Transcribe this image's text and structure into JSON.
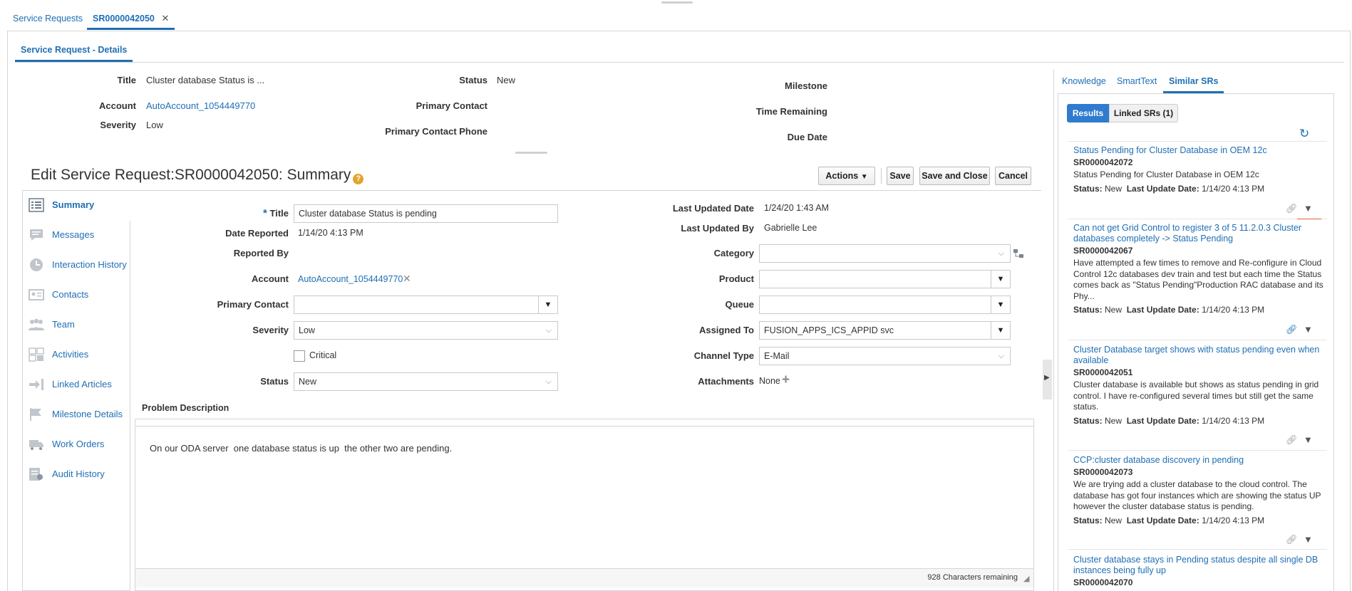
{
  "tabs": [
    {
      "label": "Service Requests"
    },
    {
      "label": "SR0000042050"
    }
  ],
  "subtab": "Service Request - Details",
  "header": {
    "title_label": "Title",
    "title_value": "Cluster database Status is ...",
    "account_label": "Account",
    "account_value": "AutoAccount_1054449770",
    "severity_label": "Severity",
    "severity_value": "Low",
    "status_label": "Status",
    "status_value": "New",
    "primary_contact_label": "Primary Contact",
    "primary_contact_phone_label": "Primary Contact Phone",
    "milestone_label": "Milestone",
    "time_remaining_label": "Time Remaining",
    "due_date_label": "Due Date"
  },
  "edit": {
    "heading": "Edit Service Request:SR0000042050: Summary",
    "actions_label": "Actions",
    "save_label": "Save",
    "save_close_label": "Save and Close",
    "cancel_label": "Cancel"
  },
  "sidebar": {
    "items": [
      {
        "label": "Summary",
        "icon": "list-icon"
      },
      {
        "label": "Messages",
        "icon": "message-icon"
      },
      {
        "label": "Interaction History",
        "icon": "clock-icon"
      },
      {
        "label": "Contacts",
        "icon": "contact-card-icon"
      },
      {
        "label": "Team",
        "icon": "team-icon"
      },
      {
        "label": "Activities",
        "icon": "activities-icon"
      },
      {
        "label": "Linked Articles",
        "icon": "linked-articles-icon"
      },
      {
        "label": "Milestone Details",
        "icon": "flag-icon"
      },
      {
        "label": "Work Orders",
        "icon": "truck-icon"
      },
      {
        "label": "Audit History",
        "icon": "audit-icon"
      }
    ]
  },
  "form": {
    "required_star": "*",
    "title_label": "Title",
    "title_value": "Cluster database Status is pending",
    "date_reported_label": "Date Reported",
    "date_reported_value": "1/14/20 4:13 PM",
    "reported_by_label": "Reported By",
    "account_label": "Account",
    "account_value": "AutoAccount_1054449770",
    "primary_contact_label": "Primary Contact",
    "severity_label": "Severity",
    "severity_value": "Low",
    "critical_label": "Critical",
    "status_label": "Status",
    "status_value": "New",
    "last_updated_date_label": "Last Updated Date",
    "last_updated_date_value": "1/24/20 1:43 AM",
    "last_updated_by_label": "Last Updated By",
    "last_updated_by_value": "Gabrielle Lee",
    "category_label": "Category",
    "product_label": "Product",
    "queue_label": "Queue",
    "assigned_to_label": "Assigned To",
    "assigned_to_value": "FUSION_APPS_ICS_APPID svc",
    "channel_type_label": "Channel Type",
    "channel_type_value": "E-Mail",
    "attachments_label": "Attachments",
    "attachments_value": "None",
    "problem_description_label": "Problem Description",
    "problem_description_value": "On our ODA server  one database status is up  the other two are pending.",
    "chars_remaining": "928 Characters remaining"
  },
  "right_panel": {
    "tabs": [
      {
        "label": "Knowledge"
      },
      {
        "label": "SmartText"
      },
      {
        "label": "Similar SRs"
      }
    ],
    "results_label": "Results",
    "linked_label": "Linked SRs (1)",
    "status_key": "Status:",
    "last_update_key": "Last Update Date:",
    "results": [
      {
        "title": "Status Pending for Cluster Database in OEM 12c",
        "number": "SR0000042072",
        "description": "Status Pending for Cluster Database in OEM 12c",
        "status": "New",
        "last_update": "1/14/20 4:13 PM"
      },
      {
        "title": "Can not get Grid Control to register 3 of 5 11.2.0.3 Cluster databases completely -> Status Pending",
        "number": "SR0000042067",
        "description": "Have attempted a few times to remove and Re-configure in Cloud Control 12c databases dev train and test but each time the Status comes back as \"Status Pending\"Production RAC database and its Phy...",
        "status": "New",
        "last_update": "1/14/20 4:13 PM"
      },
      {
        "title": "Cluster Database target shows with status pending even when available",
        "number": "SR0000042051",
        "description": "Cluster database is available but shows as status pending in grid control. I have re-configured several times but still get the same status.",
        "status": "New",
        "last_update": "1/14/20 4:13 PM"
      },
      {
        "title": "CCP:cluster database discovery in pending",
        "number": "SR0000042073",
        "description": "We are trying add a cluster database to the cloud control. The database has got four instances which are showing the status UP however the cluster database status is pending.",
        "status": "New",
        "last_update": "1/14/20 4:13 PM"
      },
      {
        "title": "Cluster database stays in Pending status despite all single DB instances being fully up",
        "number": "SR0000042070"
      }
    ]
  },
  "colors": {
    "accent": "#1f6fb4",
    "button_blue": "#2e7bcf",
    "border": "#d6d6d6"
  }
}
